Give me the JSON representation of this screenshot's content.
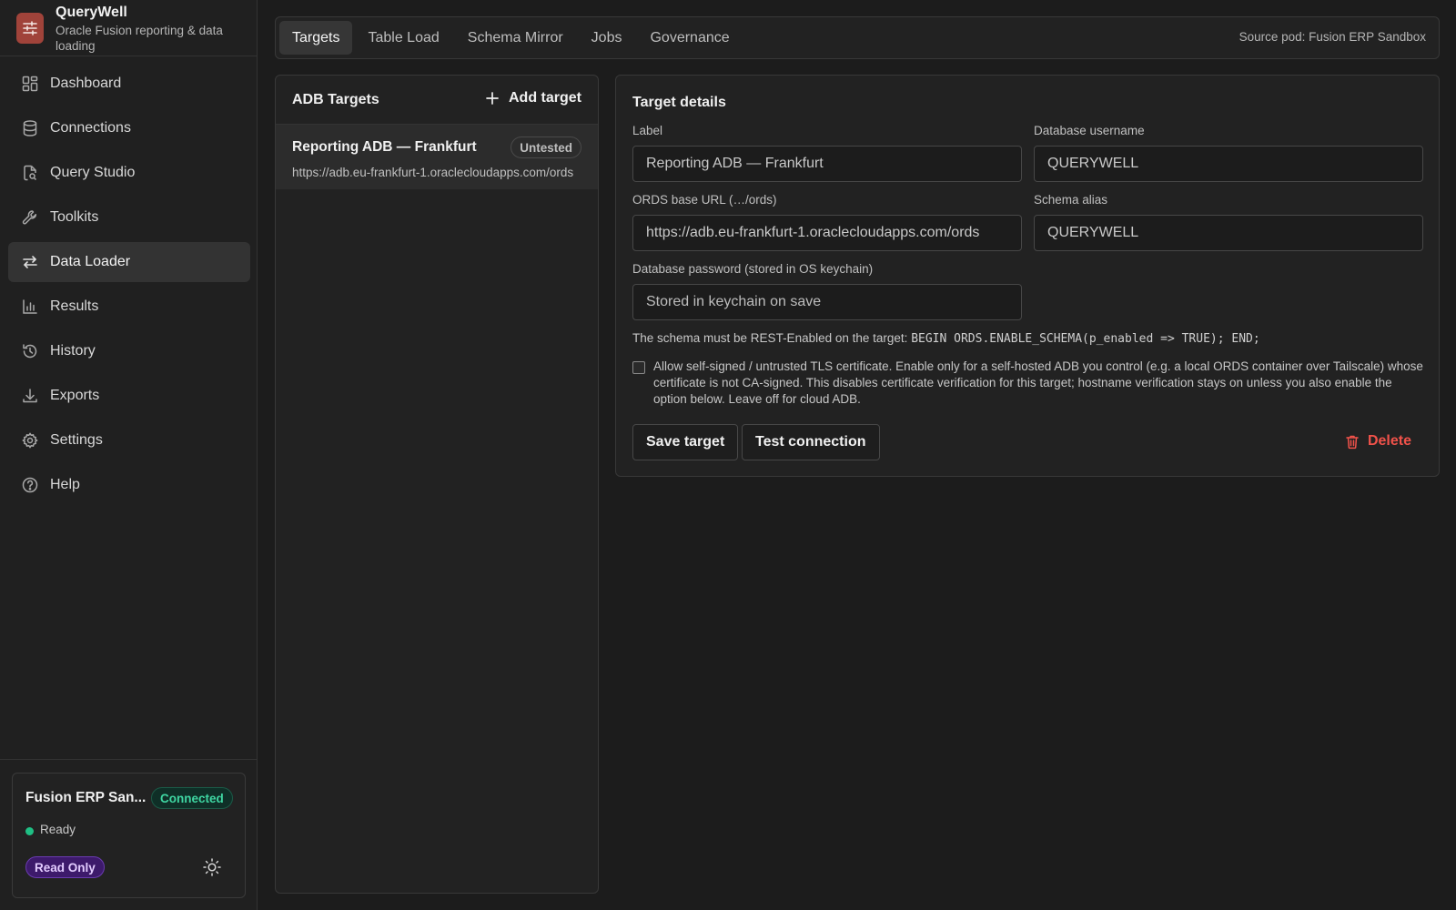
{
  "app": {
    "name": "QueryWell",
    "subtitle": "Oracle Fusion reporting & data loading"
  },
  "sidebar": {
    "items": [
      {
        "label": "Dashboard",
        "icon": "dashboard-icon"
      },
      {
        "label": "Connections",
        "icon": "database-icon"
      },
      {
        "label": "Query Studio",
        "icon": "file-search-icon"
      },
      {
        "label": "Toolkits",
        "icon": "wrench-icon"
      },
      {
        "label": "Data Loader",
        "icon": "arrows-exchange-icon",
        "active": true
      },
      {
        "label": "Results",
        "icon": "bar-chart-icon"
      },
      {
        "label": "History",
        "icon": "history-icon"
      },
      {
        "label": "Exports",
        "icon": "download-icon"
      },
      {
        "label": "Settings",
        "icon": "gear-icon"
      },
      {
        "label": "Help",
        "icon": "help-circle-icon"
      }
    ],
    "connection": {
      "name": "Fusion ERP San...",
      "status_badge": "Connected",
      "state": "Ready",
      "mode_badge": "Read Only"
    }
  },
  "tabs": {
    "items": [
      "Targets",
      "Table Load",
      "Schema Mirror",
      "Jobs",
      "Governance"
    ],
    "active": "Targets",
    "source_pod": "Source pod: Fusion ERP Sandbox"
  },
  "targets_list": {
    "title": "ADB Targets",
    "add_label": "Add target",
    "items": [
      {
        "name": "Reporting ADB — Frankfurt",
        "status": "Untested",
        "url": "https://adb.eu-frankfurt-1.oraclecloudapps.com/ords"
      }
    ]
  },
  "details": {
    "title": "Target details",
    "label_label": "Label",
    "label_value": "Reporting ADB — Frankfurt",
    "username_label": "Database username",
    "username_value": "QUERYWELL",
    "ords_label": "ORDS base URL (…/ords)",
    "ords_value": "https://adb.eu-frankfurt-1.oraclecloudapps.com/ords",
    "schema_alias_label": "Schema alias",
    "schema_alias_value": "QUERYWELL",
    "password_label": "Database password (stored in OS keychain)",
    "password_placeholder": "Stored in keychain on save",
    "schema_note": "The schema must be REST-Enabled on the target:",
    "schema_note_code": "BEGIN ORDS.ENABLE_SCHEMA(p_enabled => TRUE); END;",
    "tls_text": "Allow self-signed / untrusted TLS certificate. Enable only for a self-hosted ADB you control (e.g. a local ORDS container over Tailscale) whose certificate is not CA-signed. This disables certificate verification for this target; hostname verification stays on unless you also enable the option below. Leave off for cloud ADB.",
    "save_label": "Save target",
    "test_label": "Test connection",
    "delete_label": "Delete"
  },
  "colors": {
    "accent_logo": "#a0433a",
    "connected": "#3fd6a2",
    "read_only": "#3d1a6b",
    "danger": "#f0524a"
  }
}
